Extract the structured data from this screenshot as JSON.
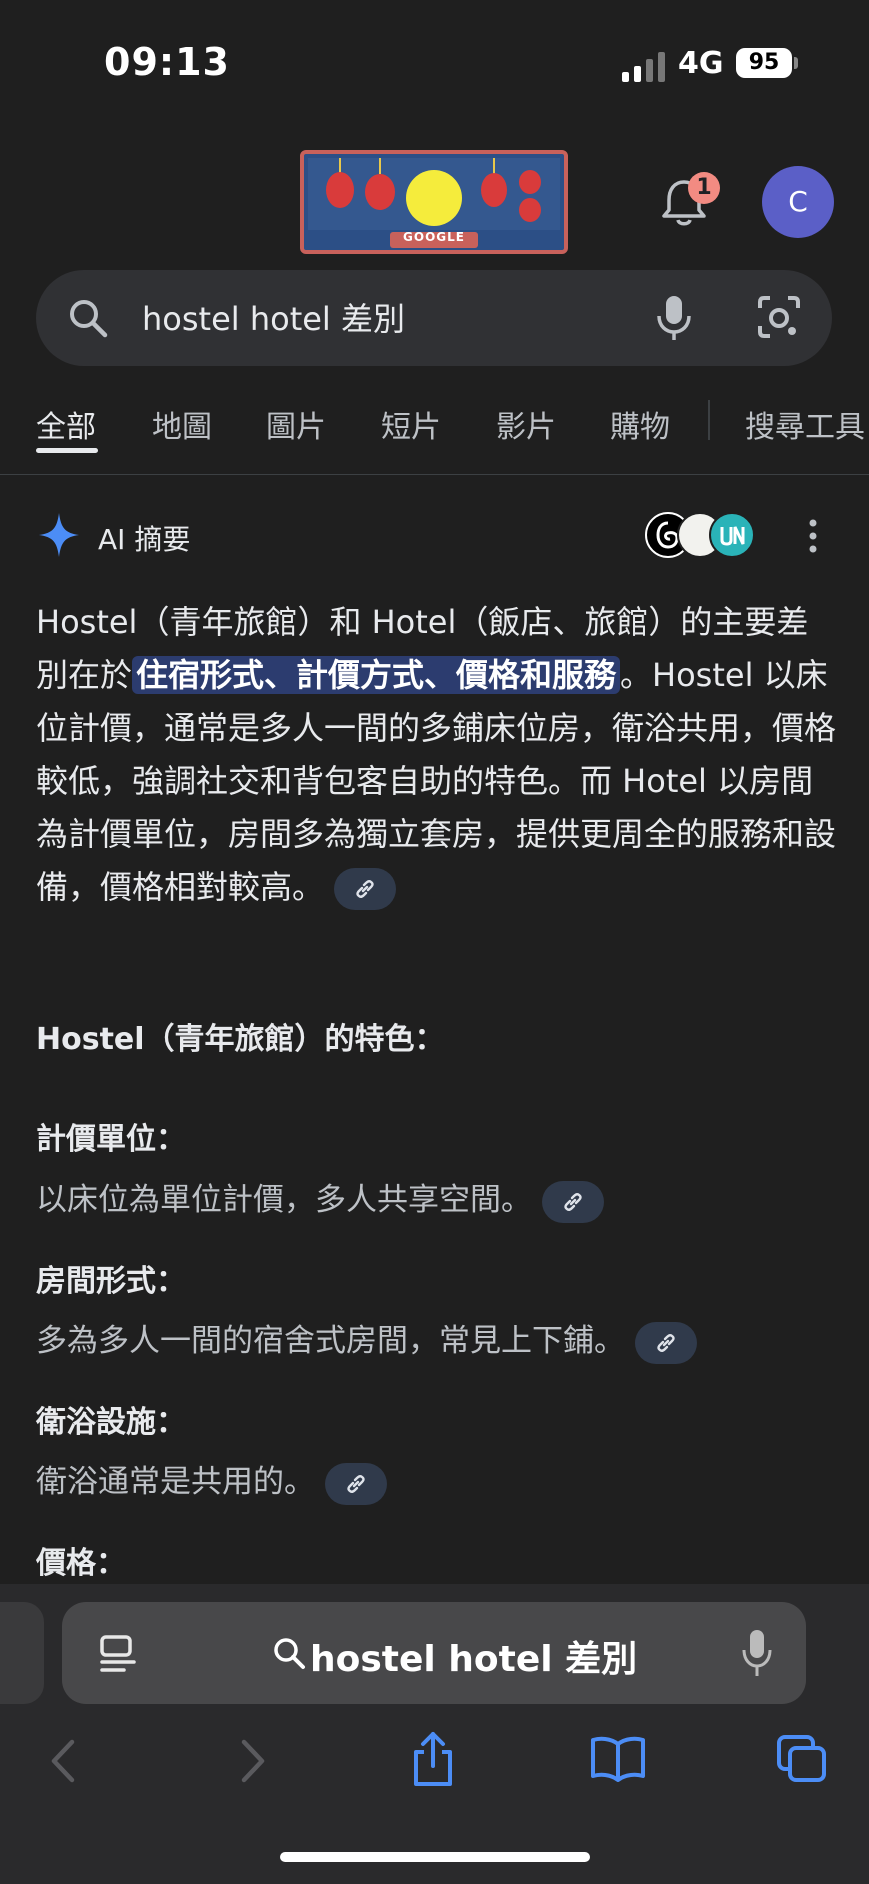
{
  "status": {
    "time": "09:13",
    "network": "4G",
    "battery": "95"
  },
  "header": {
    "doodle_label": "GOOGLE",
    "notification_count": "1",
    "avatar_letter": "C"
  },
  "search": {
    "query": "hostel hotel 差別"
  },
  "tabs": [
    {
      "label": "全部",
      "active": true
    },
    {
      "label": "地圖"
    },
    {
      "label": "圖片"
    },
    {
      "label": "短片"
    },
    {
      "label": "影片"
    },
    {
      "label": "購物"
    },
    {
      "label": "搜尋工具"
    }
  ],
  "ai": {
    "title": "AI 摘要",
    "summary_pre": "Hostel（青年旅館）和 Hotel（飯店、旅館）的主要差別在於",
    "summary_highlight": "住宿形式、計價方式、價格和服務",
    "summary_post": "。Hostel 以床位計價，通常是多人一間的多鋪床位房，衛浴共用，價格較低，強調社交和背包客自助的特色。而 Hotel 以房間為計價單位，房間多為獨立套房，提供更周全的服務和設備，價格相對較高。",
    "section_title": "Hostel（青年旅館）的特色：",
    "items": [
      {
        "title": "計價單位：",
        "desc": "以床位為單位計價，多人共享空間。"
      },
      {
        "title": "房間形式：",
        "desc": "多為多人一間的宿舍式房間，常見上下鋪。"
      },
      {
        "title": "衛浴設施：",
        "desc": "衛浴通常是共用的。"
      },
      {
        "title": "價格：",
        "desc": ""
      }
    ]
  },
  "browser": {
    "url_text": "hostel hotel 差別"
  },
  "colors": {
    "background": "#1f1f1f",
    "highlight": "#2c3c6f",
    "accent_blue": "#4c8df6",
    "avatar": "#5b5fc7",
    "badge": "#f28b82"
  }
}
